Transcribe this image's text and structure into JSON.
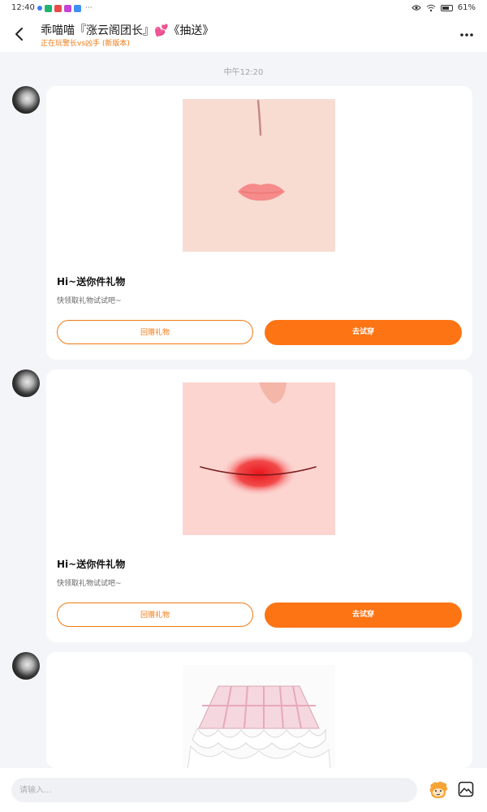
{
  "status_bar": {
    "time": "12:40",
    "more": "···",
    "battery": "61%",
    "icons": [
      "eye-icon",
      "wifi-icon",
      "battery-icon"
    ]
  },
  "header": {
    "title": "乖喵喵『涨云阁团长』💕《抽送》",
    "subtitle": "正在玩警长vs凶手 (新版本)",
    "back_icon": "back-arrow-icon",
    "more_icon": "more-icon"
  },
  "timestamp": "中午12:20",
  "messages": [
    {
      "title": "Hi~送你件礼物",
      "desc": "快领取礼物试试吧~",
      "return_gift_label": "回赠礼物",
      "try_on_label": "去试穿",
      "image": "lips-pink-item"
    },
    {
      "title": "Hi~送你件礼物",
      "desc": "快领取礼物试试吧~",
      "return_gift_label": "回赠礼物",
      "try_on_label": "去试穿",
      "image": "lips-red-item"
    },
    {
      "image": "pink-skirt-item"
    }
  ],
  "input_bar": {
    "placeholder": "请输入...",
    "emoji_icon": "emoji-icon",
    "image_icon": "image-icon"
  },
  "colors": {
    "accent": "#fd7414",
    "outline": "#f07a14",
    "background": "#f4f5f8"
  }
}
